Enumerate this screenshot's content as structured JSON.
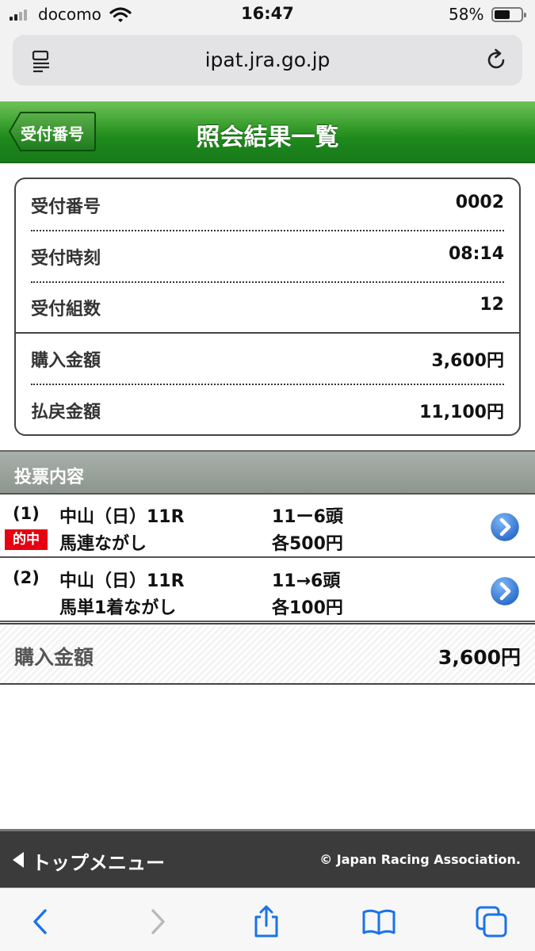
{
  "status_bar": {
    "carrier": "docomo",
    "time": "16:47",
    "battery_percent": "58%",
    "battery_level": 0.58
  },
  "browser": {
    "url": "ipat.jra.go.jp"
  },
  "header": {
    "back_label": "受付番号",
    "title": "照会結果一覧",
    "accent_color": "#2a9126"
  },
  "summary": {
    "rows": [
      {
        "label": "受付番号",
        "value": "0002"
      },
      {
        "label": "受付時刻",
        "value": "08:14"
      },
      {
        "label": "受付組数",
        "value": "12"
      },
      {
        "label": "購入金額",
        "value": "3,600円"
      },
      {
        "label": "払戻金額",
        "value": "11,100円"
      }
    ]
  },
  "section": {
    "title": "投票内容"
  },
  "bets": [
    {
      "index": "(1)",
      "race": "中山（日）11R",
      "bet_type": "馬連ながし",
      "combination": "11ー6頭",
      "amount": "各500円",
      "badge": "的中"
    },
    {
      "index": "(2)",
      "race": "中山（日）11R",
      "bet_type": "馬単1着ながし",
      "combination": "11→6頭",
      "amount": "各100円"
    }
  ],
  "total": {
    "label": "購入金額",
    "value": "3,600円"
  },
  "footer": {
    "menu_label": "トップメニュー",
    "copyright": "© Japan Racing Association."
  }
}
